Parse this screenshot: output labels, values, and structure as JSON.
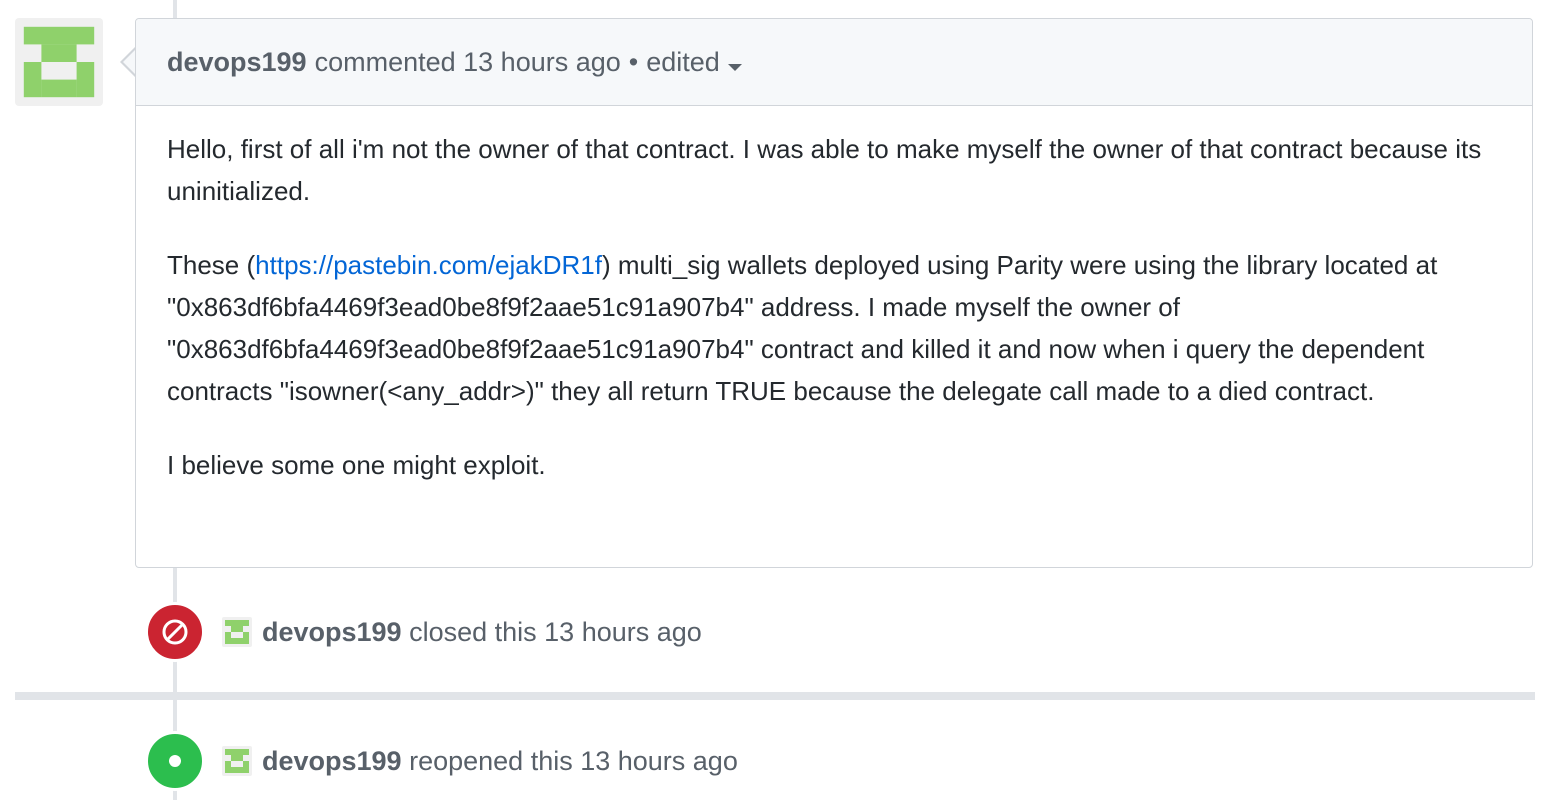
{
  "colors": {
    "avatar_green": "#8fd16b",
    "closed_red": "#cb2431",
    "reopened_green": "#2cbe4e",
    "link_blue": "#0366d6"
  },
  "comment": {
    "author": "devops199",
    "action": "commented 13 hours ago",
    "edited_label": "edited",
    "paragraph1": "Hello, first of all i'm not the owner of that contract. I was able to make myself the owner of that contract because its uninitialized.",
    "paragraph2_prefix": "These (",
    "paragraph2_link": "https://pastebin.com/ejakDR1f",
    "paragraph2_suffix": ") multi_sig wallets deployed using Parity were using the library located at \"0x863df6bfa4469f3ead0be8f9f2aae51c91a907b4\" address. I made myself the owner of \"0x863df6bfa4469f3ead0be8f9f2aae51c91a907b4\" contract and killed it and now when i query the dependent contracts \"isowner(<any_addr>)\" they all return TRUE because the delegate call made to a died contract.",
    "paragraph3": "I believe some one might exploit."
  },
  "events": [
    {
      "type": "closed",
      "icon": "closed-circle-slash-icon",
      "author": "devops199",
      "text": "closed this 13 hours ago"
    },
    {
      "type": "reopened",
      "icon": "reopened-dot-icon",
      "author": "devops199",
      "text": "reopened this 13 hours ago"
    }
  ]
}
